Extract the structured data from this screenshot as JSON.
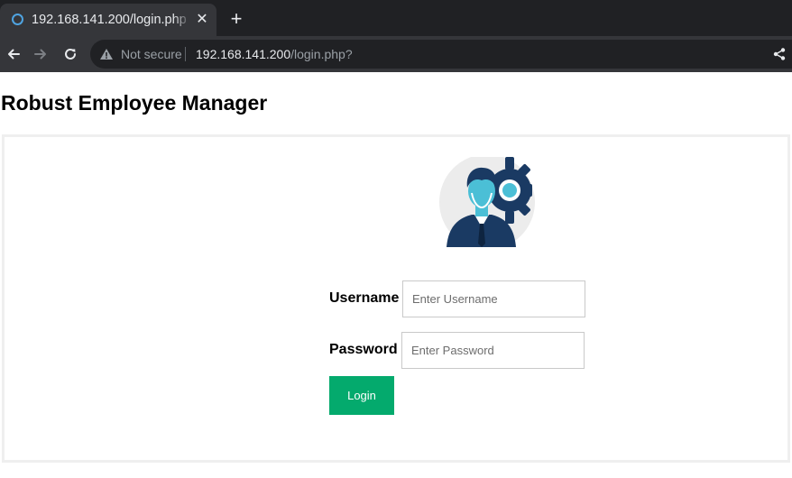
{
  "browser": {
    "tab_title": "192.168.141.200/login.php",
    "tab_close": "✕",
    "new_tab": "+",
    "security_label": "Not secure",
    "url_host": "192.168.141.200",
    "url_path": "/login.php?",
    "icons": [
      "back-arrow-icon",
      "forward-arrow-icon",
      "reload-icon",
      "warning-icon",
      "share-icon",
      "favicon-icon"
    ]
  },
  "page": {
    "title": "Robust Employee Manager",
    "avatar_icon": "employee-gear-avatar",
    "colors": {
      "accent": "#04aa6d",
      "avatar_dark": "#1a3a63",
      "avatar_light": "#4bbfd6"
    }
  },
  "form": {
    "username_label": "Username",
    "username_placeholder": "Enter Username",
    "username_value": "",
    "password_label": "Password",
    "password_placeholder": "Enter Password",
    "password_value": "",
    "login_label": "Login"
  }
}
